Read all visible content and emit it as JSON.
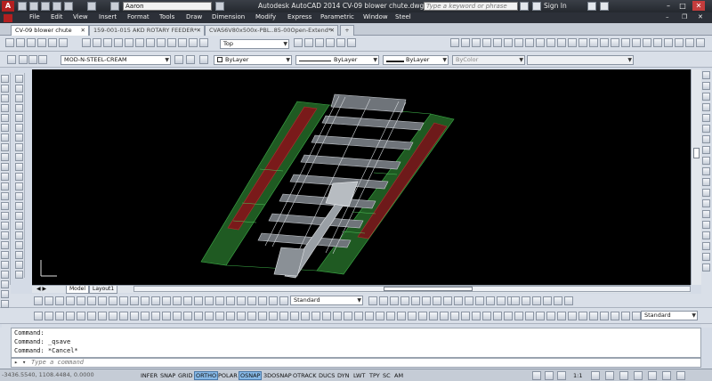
{
  "app": {
    "quick_user": "Aaron",
    "title": "Autodesk AutoCAD 2014   CV-09 blower chute.dwg",
    "search_placeholder": "Type a keyword or phrase",
    "sign_in": "Sign In"
  },
  "menu": [
    "File",
    "Edit",
    "View",
    "Insert",
    "Format",
    "Tools",
    "Draw",
    "Dimension",
    "Modify",
    "Express",
    "Parametric",
    "Window",
    "Steel"
  ],
  "tabs": [
    {
      "label": "CV-09 blower chute",
      "active": true
    },
    {
      "label": "159-001-015 AKD ROTARY FEEDER*",
      "active": false
    },
    {
      "label": "CVAS6V80x500x-PBL..85-00Open-Extend*",
      "active": false
    }
  ],
  "toolbar": {
    "view_select": "Top",
    "layer_select": "MOD-N-STEEL-CREAM",
    "color_select": "ByLayer",
    "linetype_select": "ByLayer",
    "lineweight_select": "ByLayer",
    "plotstyle_select": "ByColor",
    "textstyle_select": "Standard",
    "dimstyle_select": "Standard"
  },
  "layout_tabs": [
    {
      "label": "Model",
      "active": true
    },
    {
      "label": "Layout1",
      "active": false
    }
  ],
  "command": {
    "history": [
      "Command:",
      "Command: _qsave",
      "Command: *Cancel*"
    ],
    "placeholder": "Type a command"
  },
  "status": {
    "coords": "-3436.5540, 1108.4484, 0.0000",
    "toggles": [
      {
        "label": "INFER",
        "on": false
      },
      {
        "label": "SNAP",
        "on": false
      },
      {
        "label": "GRID",
        "on": false
      },
      {
        "label": "ORTHO",
        "on": true
      },
      {
        "label": "POLAR",
        "on": false
      },
      {
        "label": "OSNAP",
        "on": true
      },
      {
        "label": "3DOSNAP",
        "on": false
      },
      {
        "label": "OTRACK",
        "on": false
      },
      {
        "label": "DUCS",
        "on": false
      },
      {
        "label": "DYN",
        "on": false
      },
      {
        "label": "LWT",
        "on": false
      },
      {
        "label": "TPY",
        "on": false
      },
      {
        "label": "SC",
        "on": false
      },
      {
        "label": "AM",
        "on": false
      }
    ],
    "scale": "1:1"
  },
  "colors": {
    "canvas": "#000000",
    "model_green": "#2f9a3a",
    "model_red": "#8a1f1f",
    "model_grey": "#bfc4c9"
  }
}
